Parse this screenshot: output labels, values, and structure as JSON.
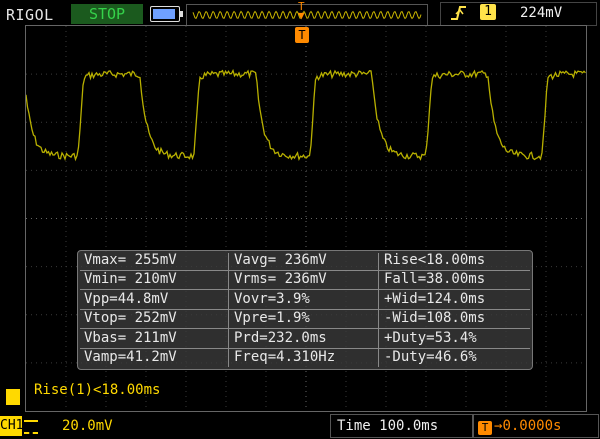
{
  "header": {
    "brand": "RIGOL",
    "run_state": "STOP",
    "trigger": {
      "edge_icon": "rising-edge-icon",
      "channel": "1",
      "level": "224mV"
    },
    "trig_marker": "T"
  },
  "measurements": [
    [
      "Vmax= 255mV",
      "Vavg= 236mV",
      "Rise<18.00ms"
    ],
    [
      "Vmin= 210mV",
      "Vrms= 236mV",
      "Fall=38.00ms"
    ],
    [
      "Vpp=44.8mV",
      "Vovr=3.9%",
      "+Wid=124.0ms"
    ],
    [
      "Vtop= 252mV",
      "Vpre=1.9%",
      "-Wid=108.0ms"
    ],
    [
      "Vbas= 211mV",
      "Prd=232.0ms",
      "+Duty=53.4%"
    ],
    [
      "Vamp=41.2mV",
      "Freq=4.310Hz",
      "-Duty=46.6%"
    ]
  ],
  "status_message": "Rise(1)<18.00ms",
  "footer": {
    "channel_label": "CH1",
    "scale": "20.0mV",
    "time_label": "Time",
    "time_value": "100.0ms",
    "trigger_offset": "0.0000s"
  },
  "colors": {
    "trace": "#b8b000",
    "grid": "#3a3a3a",
    "trigger": "#ff8a00",
    "channel": "#ffd900",
    "run_state": "#35d24a"
  }
}
